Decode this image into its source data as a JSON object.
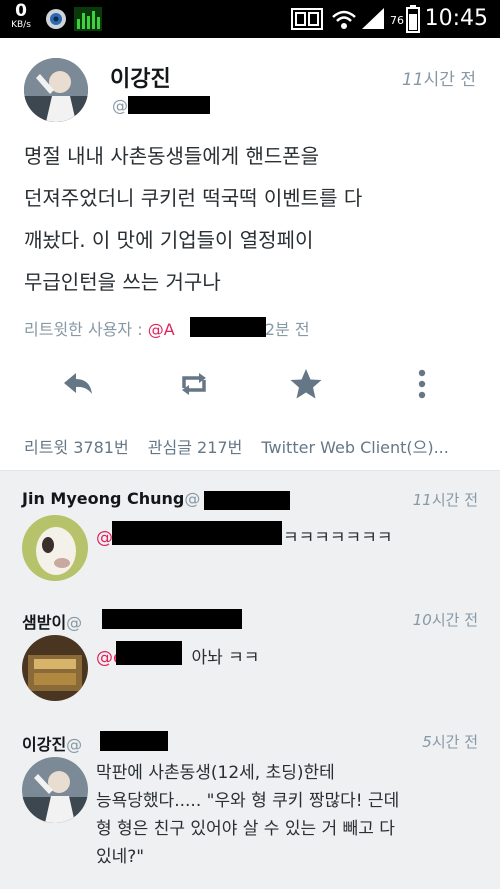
{
  "status_bar": {
    "speed_value": "0",
    "speed_unit": "KB/s",
    "battery": "76",
    "time": "10:45"
  },
  "main_tweet": {
    "name": "이강진",
    "handle": "@",
    "time_num": "11",
    "time_unit": "시간 전",
    "body": [
      "명절 내내 사촌동생들에게 핸드폰을",
      "던져주었더니 쿠키런 떡국떡 이벤트를 다",
      "깨놨다. 이 맛에 기업들이 열정페이",
      "무급인턴을 쓰는 거구나"
    ],
    "retweet_label": "리트윗한 사용자 :",
    "retweet_handle": "@A",
    "retweet_time": "2분 전",
    "actions": [
      "reply-icon",
      "retweet-icon",
      "favorite-icon",
      "more-icon"
    ],
    "stats": {
      "retweets": "리트윗 3781번",
      "favorites": "관심글 217번",
      "client": "Twitter Web Client(으)..."
    }
  },
  "replies": [
    {
      "name": "Jin Myeong Chung",
      "handle": "@",
      "time_num": "11",
      "time_unit": "시간 전",
      "mention": "@",
      "text": "ㅋㅋㅋㅋㅋㅋㅋ"
    },
    {
      "name": "샘받이",
      "handle": "@",
      "time_num": "10",
      "time_unit": "시간 전",
      "mention": "@e",
      "text": "아놔 ㅋㅋ"
    },
    {
      "name": "이강진",
      "handle": "@",
      "time_num": "5",
      "time_unit": "시간 전",
      "lines": [
        "막판에 사촌동생(12세, 초딩)한테",
        "능욕당했다..... \"우와 형 쿠키 짱많다! 근데",
        "형 형은 친구 있어야 살 수 있는 거 빼고 다",
        "있네?\""
      ]
    }
  ],
  "colors": {
    "mention": "#e0245e",
    "muted": "#8899a6",
    "reply_bg": "#eef0f2"
  }
}
